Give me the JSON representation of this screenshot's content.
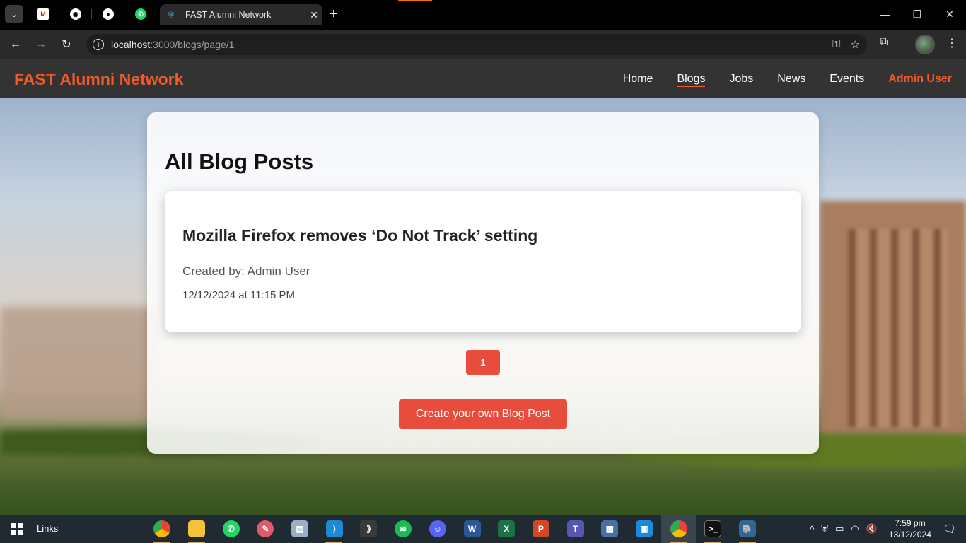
{
  "browser": {
    "active_tab_title": "FAST Alumni Network",
    "url_host": "localhost",
    "url_path": ":3000/blogs/page/1",
    "pinned_tabs": [
      "gmail-icon",
      "chatgpt-icon",
      "github-icon",
      "whatsapp-icon"
    ]
  },
  "app": {
    "brand": "FAST Alumni Network",
    "nav": [
      {
        "label": "Home"
      },
      {
        "label": "Blogs"
      },
      {
        "label": "Jobs"
      },
      {
        "label": "News"
      },
      {
        "label": "Events"
      },
      {
        "label": "Admin User"
      }
    ]
  },
  "main": {
    "heading": "All Blog Posts",
    "posts": [
      {
        "title": "Mozilla Firefox removes ‘Do Not Track’ setting",
        "created_by": "Created by: Admin User",
        "date": "12/12/2024 at 11:15 PM"
      }
    ],
    "pagination": {
      "current_page": "1"
    },
    "create_button": "Create your own Blog Post"
  },
  "taskbar": {
    "links_label": "Links",
    "time": "7:59 pm",
    "date": "13/12/2024",
    "apps": [
      "chrome-icon",
      "file-explorer-icon",
      "whatsapp-icon",
      "paint-icon",
      "photo-viewer-icon",
      "vscode-icon",
      "git-icon",
      "spotify-icon",
      "discord-icon",
      "word-icon",
      "excel-icon",
      "powerpoint-icon",
      "teams-icon",
      "calculator-icon",
      "vmware-icon",
      "chrome-active-icon",
      "terminal-icon",
      "postgres-icon"
    ]
  },
  "colors": {
    "brand": "#ec5b2c",
    "nav_bg": "#333333",
    "button": "#e74c3c"
  }
}
